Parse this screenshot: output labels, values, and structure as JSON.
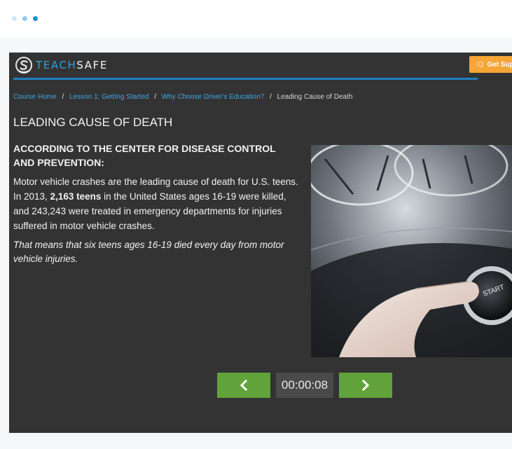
{
  "brand": {
    "teach": "TEACH",
    "safe": "SAFE"
  },
  "header": {
    "support_label": "Get Sup",
    "accent_color": "#1f7fc4",
    "support_color": "#f5a636"
  },
  "breadcrumb": {
    "items": [
      "Course Home",
      "Lesson 1: Getting Started",
      "Why Choose Driver's Education?"
    ],
    "separator": "/",
    "current": "Leading Cause of Death"
  },
  "content": {
    "title": "LEADING CAUSE OF DEATH",
    "subheading": "ACCORDING TO THE CENTER FOR DISEASE CONTROL AND PREVENTION:",
    "para_part1": "Motor vehicle crashes are the leading cause of death for U.S. teens.  In 2013, ",
    "para_bold": "2,163 teens",
    "para_part2": " in the United States ages 16-19 were killed, and 243,243 were treated in emergency departments for injuries suffered in motor vehicle crashes.",
    "italic": "That means that six teens ages 16-19 died every day from motor vehicle injuries.",
    "image_button_text": "START"
  },
  "nav": {
    "timer": "00:00:08",
    "prev_icon": "chevron-left-icon",
    "next_icon": "chevron-right-icon",
    "button_color": "#61a33a"
  }
}
